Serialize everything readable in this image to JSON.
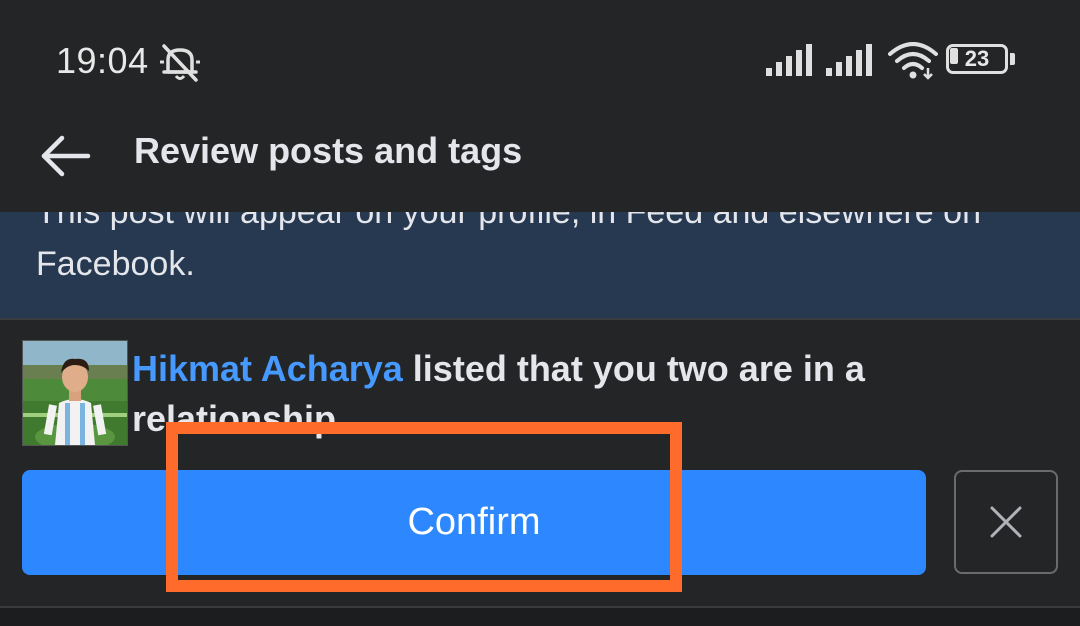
{
  "status_bar": {
    "time": "19:04",
    "battery_level": "23",
    "icons": [
      "bell-off-icon",
      "signal-icon",
      "signal-icon",
      "wifi-icon",
      "battery-icon"
    ]
  },
  "header": {
    "title": "Review posts and tags",
    "back_icon": "back-arrow-icon"
  },
  "banner": {
    "text": "This post will appear on your profile, in Feed and elsewhere on Facebook."
  },
  "tag_item": {
    "name": "Hikmat Acharya",
    "message": " listed that you two are in a relationship.",
    "confirm_label": "Confirm",
    "dismiss_icon": "close-icon"
  },
  "colors": {
    "background": "#242526",
    "banner": "#263951",
    "accent": "#2d88ff",
    "link": "#4599ff",
    "highlight": "#ff6b2b"
  }
}
